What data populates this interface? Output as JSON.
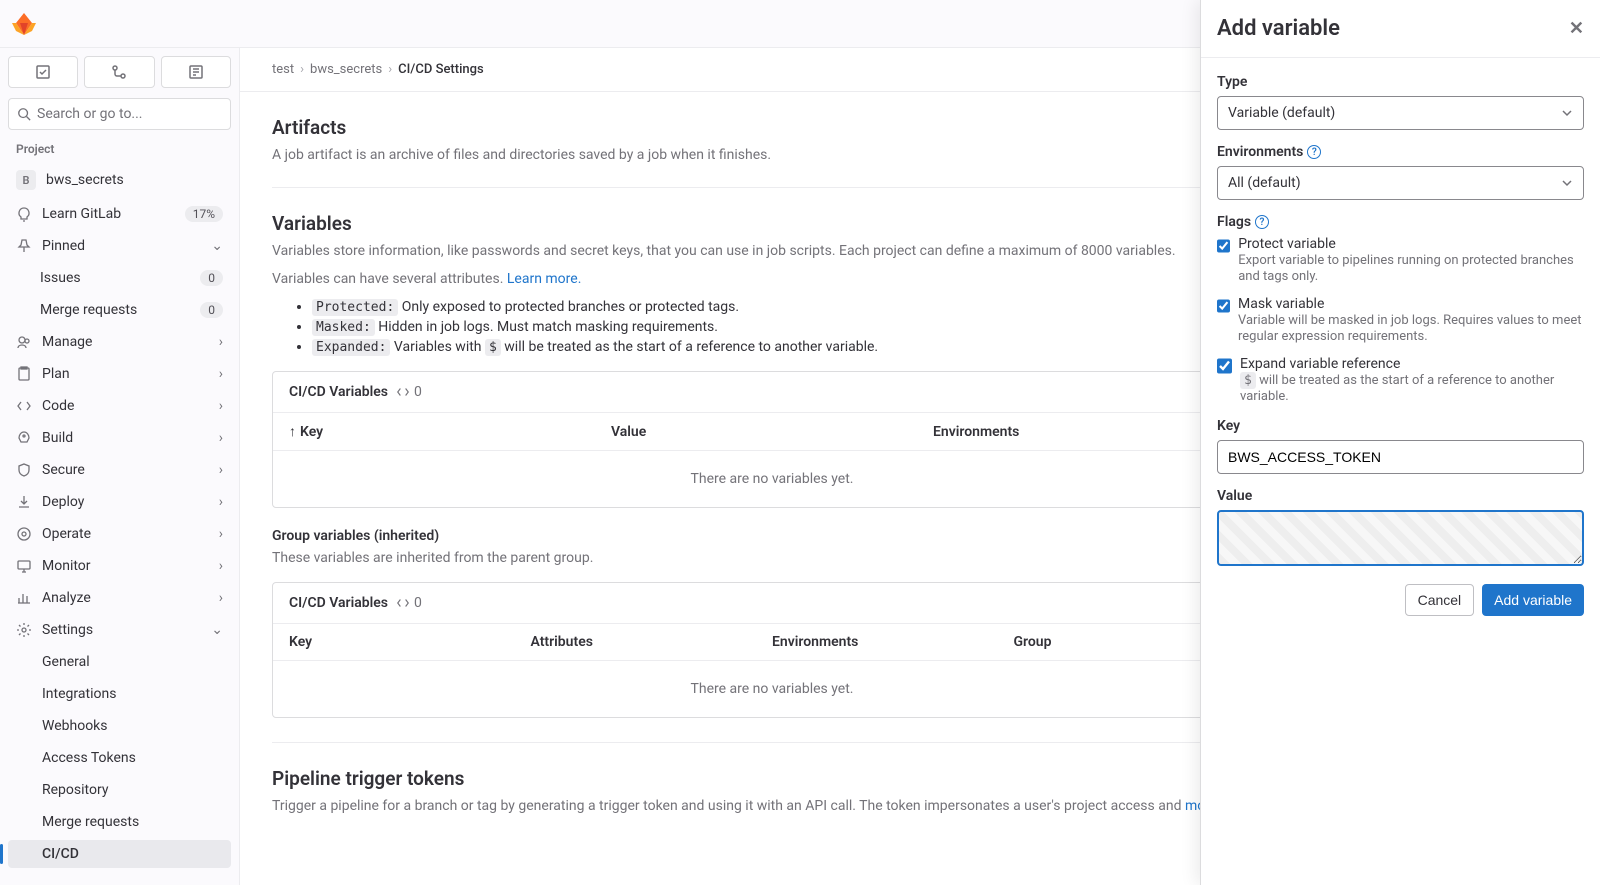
{
  "topbar": {
    "search_placeholder": "Search or go to..."
  },
  "sidebar": {
    "heading": "Project",
    "project": {
      "initial": "B",
      "name": "bws_secrets"
    },
    "learn": {
      "label": "Learn GitLab",
      "badge": "17%"
    },
    "pinned": {
      "label": "Pinned"
    },
    "issues": {
      "label": "Issues",
      "count": "0"
    },
    "mrs": {
      "label": "Merge requests",
      "count": "0"
    },
    "manage": "Manage",
    "plan": "Plan",
    "code": "Code",
    "build": "Build",
    "secure": "Secure",
    "deploy": "Deploy",
    "operate": "Operate",
    "monitor": "Monitor",
    "analyze": "Analyze",
    "settings": {
      "label": "Settings",
      "general": "General",
      "integrations": "Integrations",
      "webhooks": "Webhooks",
      "tokens": "Access Tokens",
      "repository": "Repository",
      "merge": "Merge requests",
      "cicd": "CI/CD"
    }
  },
  "breadcrumb": {
    "a": "test",
    "b": "bws_secrets",
    "c": "CI/CD Settings"
  },
  "artifacts": {
    "title": "Artifacts",
    "desc": "A job artifact is an archive of files and directories saved by a job when it finishes."
  },
  "variables": {
    "title": "Variables",
    "desc1": "Variables store information, like passwords and secret keys, that you can use in job scripts. Each project can define a maximum of 8000 variables.",
    "desc2a": "Variables can have several attributes. ",
    "learn_more": "Learn more.",
    "li_protected_code": "Protected:",
    "li_protected": " Only exposed to protected branches or protected tags.",
    "li_masked_code": "Masked:",
    "li_masked": " Hidden in job logs. Must match masking requirements.",
    "li_expanded_code": "Expanded:",
    "li_expanded_a": " Variables with ",
    "dollar": "$",
    "li_expanded_b": " will be treated as the start of a reference to another variable.",
    "card_title": "CI/CD Variables",
    "count": "0",
    "col_key": "Key",
    "col_value": "Value",
    "col_env": "Environments",
    "empty": "There are no variables yet.",
    "group_title": "Group variables (inherited)",
    "group_desc": "These variables are inherited from the parent group.",
    "col_attr": "Attributes",
    "col_group": "Group"
  },
  "triggers": {
    "title": "Pipeline trigger tokens",
    "desc": "Trigger a pipeline for a branch or tag by generating a trigger token and using it with an API call. The token impersonates a user's project access and ",
    "more": "more."
  },
  "drawer": {
    "title": "Add variable",
    "type_label": "Type",
    "type_value": "Variable (default)",
    "env_label": "Environments",
    "env_value": "All (default)",
    "flags_label": "Flags",
    "protect_title": "Protect variable",
    "protect_desc": "Export variable to pipelines running on protected branches and tags only.",
    "mask_title": "Mask variable",
    "mask_desc": "Variable will be masked in job logs. Requires values to meet regular expression requirements.",
    "expand_title": "Expand variable reference",
    "expand_desc_a": " will be treated as the start of a reference to another variable.",
    "key_label": "Key",
    "key_value": "BWS_ACCESS_TOKEN",
    "value_label": "Value",
    "cancel": "Cancel",
    "submit": "Add variable"
  }
}
